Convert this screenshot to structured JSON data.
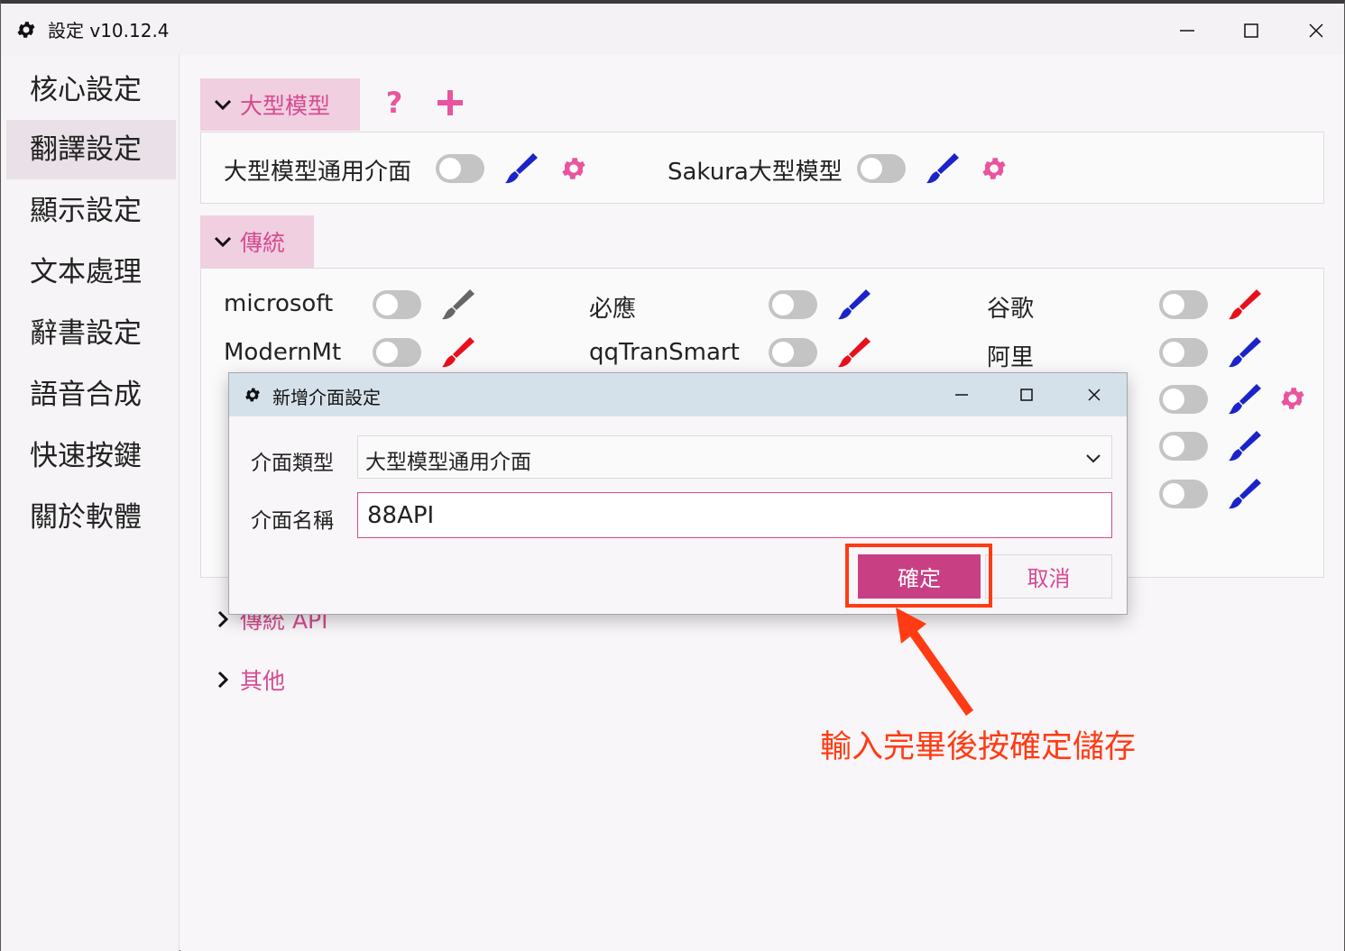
{
  "window": {
    "title": "設定 v10.12.4"
  },
  "sidebar": {
    "items": [
      {
        "label": "核心設定"
      },
      {
        "label": "翻譯設定"
      },
      {
        "label": "顯示設定"
      },
      {
        "label": "文本處理"
      },
      {
        "label": "辭書設定"
      },
      {
        "label": "語音合成"
      },
      {
        "label": "快速按鍵"
      },
      {
        "label": "關於軟體"
      }
    ],
    "active": "翻譯設定"
  },
  "sections": {
    "llm": {
      "header": "大型模型",
      "items": [
        {
          "label": "大型模型通用介面",
          "brush_color": "#1a24c9"
        },
        {
          "label": "Sakura大型模型",
          "brush_color": "#1a24c9"
        }
      ]
    },
    "traditional": {
      "header": "傳統",
      "items": [
        {
          "label": "microsoft",
          "brush_color": "#666666"
        },
        {
          "label": "必應",
          "brush_color": "#1a24c9"
        },
        {
          "label": "谷歌",
          "brush_color": "#e8101c"
        },
        {
          "label": "ModernMt",
          "brush_color": "#e8101c"
        },
        {
          "label": "qqTranSmart",
          "brush_color": "#e8101c"
        },
        {
          "label": "阿里",
          "brush_color": "#1a24c9"
        }
      ]
    },
    "traditional_api": {
      "header": "傳統 API"
    },
    "other": {
      "header": "其他"
    }
  },
  "dialog": {
    "title": "新增介面設定",
    "type_label": "介面類型",
    "type_value": "大型模型通用介面",
    "name_label": "介面名稱",
    "name_value": "88API",
    "ok_label": "確定",
    "cancel_label": "取消"
  },
  "annotation": {
    "text": "輸入完畢後按確定儲存"
  },
  "colors": {
    "accent": "#d64a91",
    "accent_dark": "#c93f84",
    "annotation": "#ff3b14"
  }
}
